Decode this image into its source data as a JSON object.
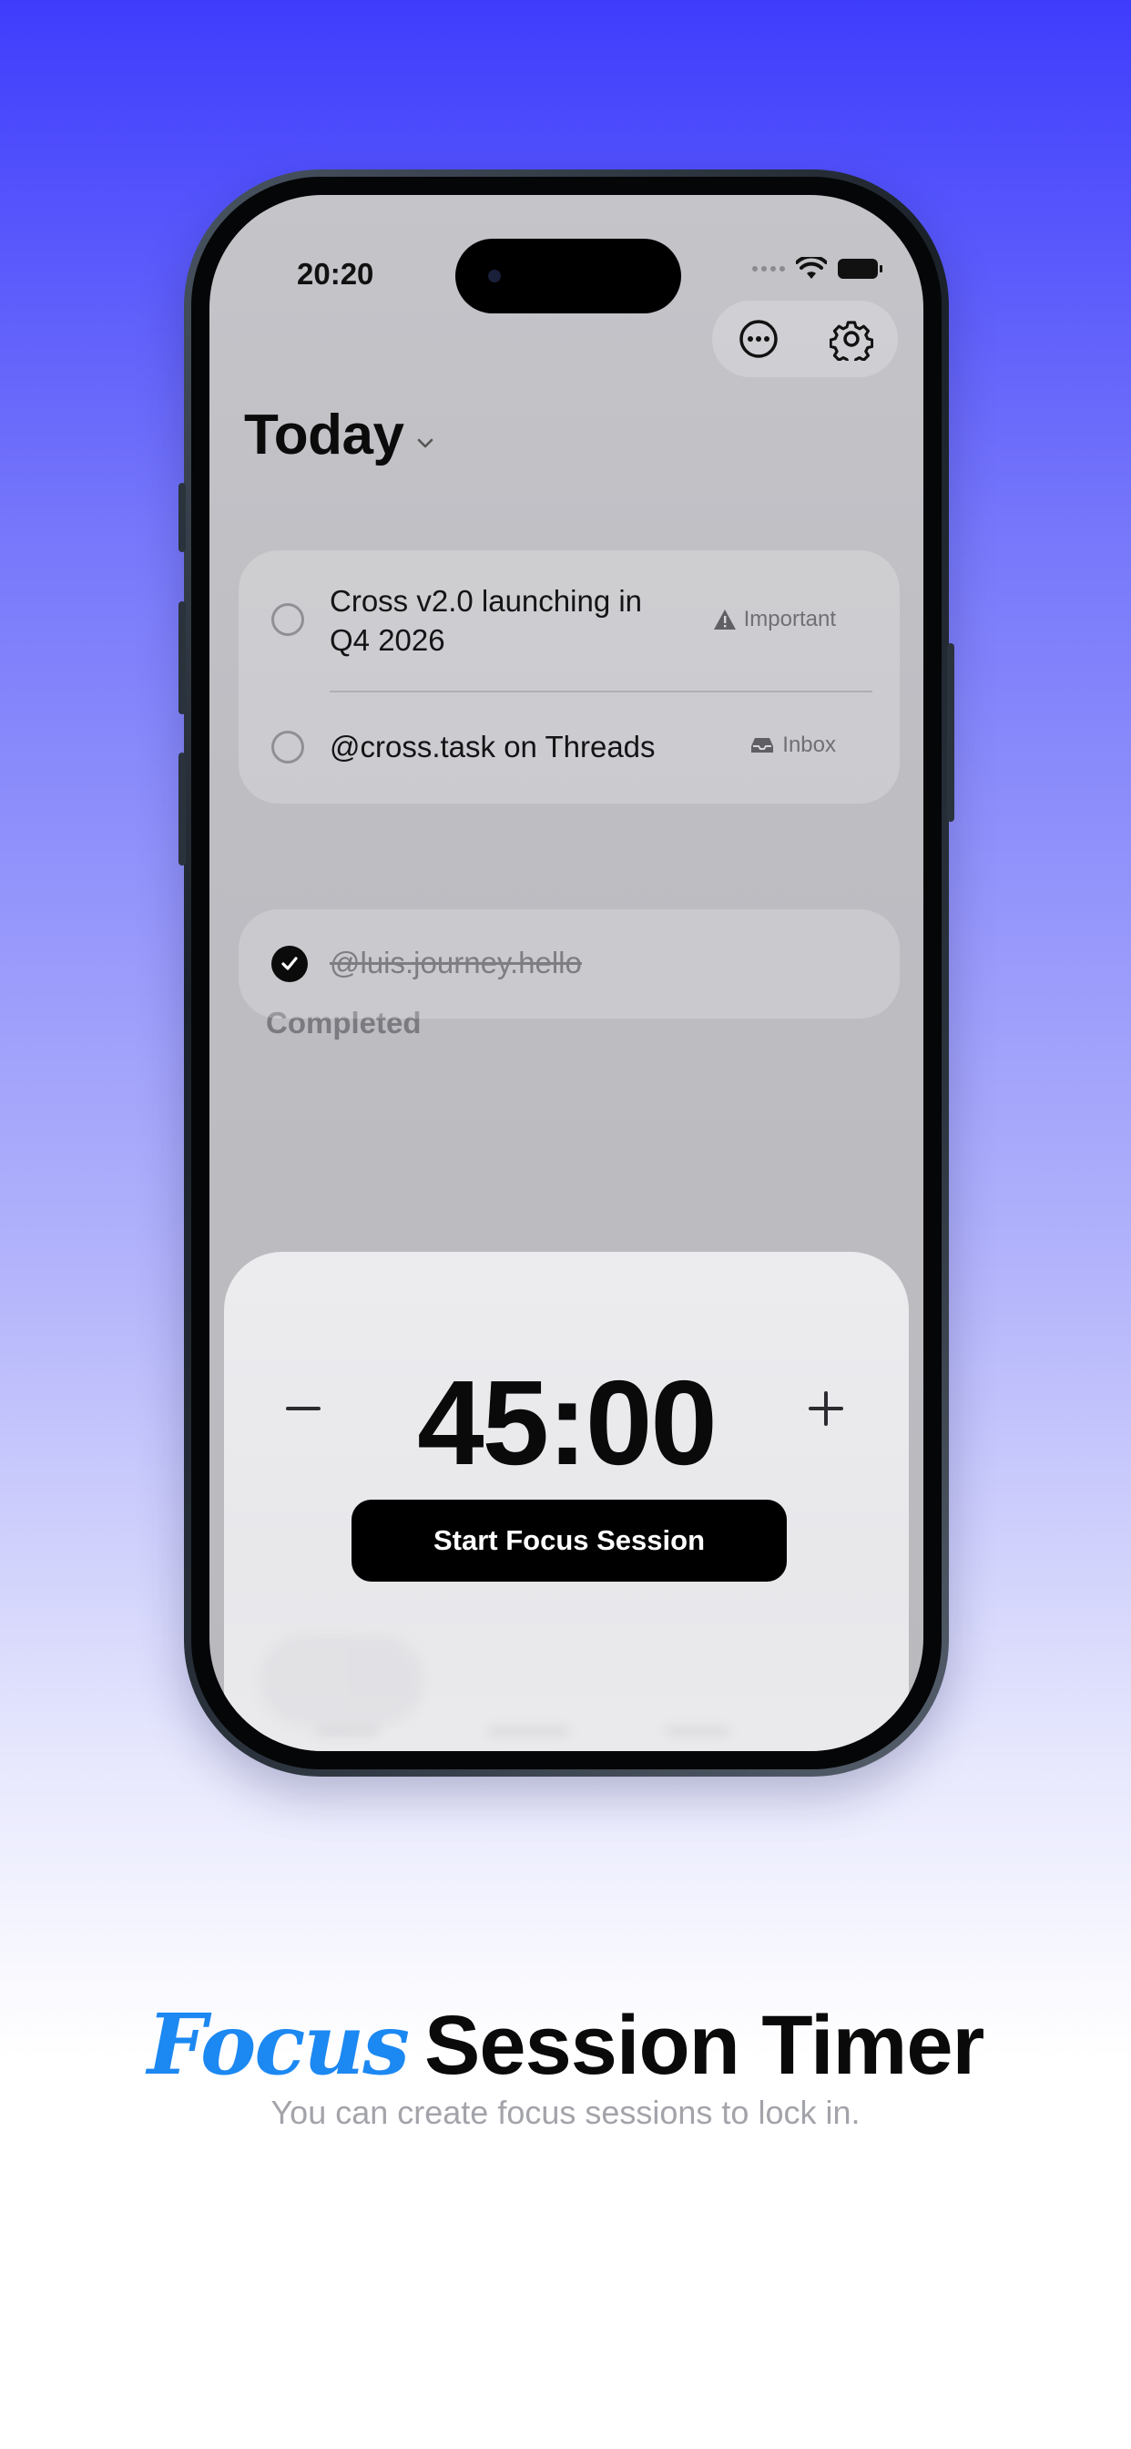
{
  "status_bar": {
    "time": "20:20"
  },
  "header": {
    "title": "Today"
  },
  "tasks": [
    {
      "text_line1": "Cross v2.0 launching in",
      "text_line2": "Q4 2026",
      "tag": "Important",
      "tag_icon": "warning-icon"
    },
    {
      "text_line1": "@cross.task on Threads",
      "tag": "Inbox",
      "tag_icon": "inbox-icon"
    }
  ],
  "completed": {
    "label": "Completed",
    "items": [
      {
        "text": "@luis.journey.hello"
      }
    ]
  },
  "focus_sheet": {
    "timer": "45:00",
    "decrement_symbol": "−",
    "increment_symbol": "+",
    "start_label": "Start Focus Session"
  },
  "caption": {
    "highlight": "Focus",
    "title": "Session Timer",
    "subtitle": "You can create focus sessions to lock in."
  },
  "colors": {
    "accent": "#1c88f2",
    "background_top": "#3f3dfc",
    "button": "#000000"
  }
}
